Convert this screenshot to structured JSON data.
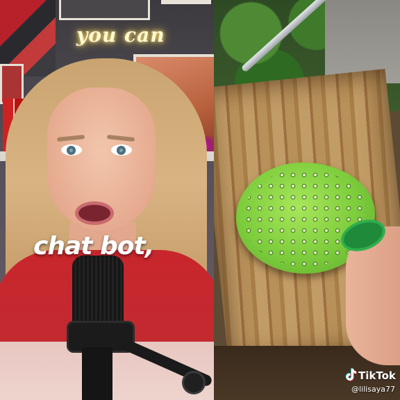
{
  "video": {
    "caption": "chat bot,",
    "neon_sign": "you can"
  },
  "watermark": {
    "brand": "TikTok",
    "username": "@lilisaya77",
    "icon": "tiktok-note-icon"
  },
  "colors": {
    "sweater": "#c8262c",
    "cactus": "#7ccc3c",
    "neon": "#ffe680"
  }
}
